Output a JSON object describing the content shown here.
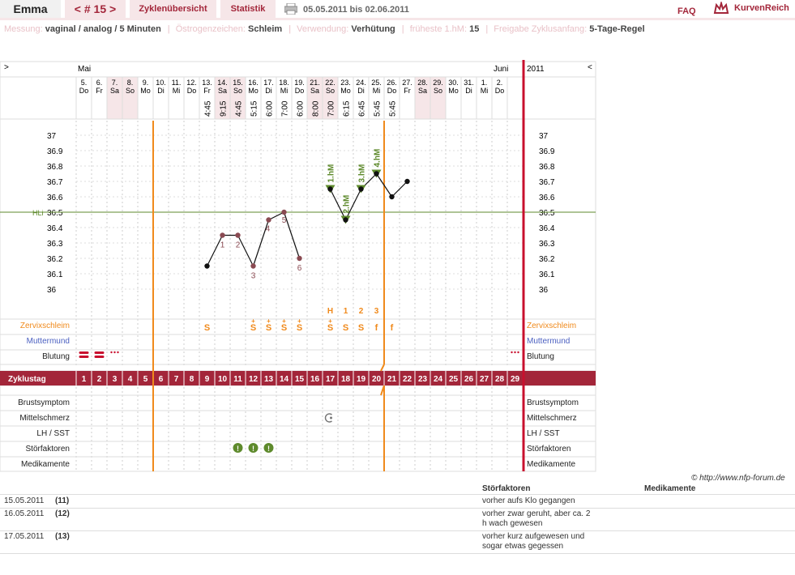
{
  "header": {
    "name": "Emma",
    "cycle_label": "< # 15 >",
    "tab_overview": "Zyklenübersicht",
    "tab_stats": "Statistik",
    "date_range": "05.05.2011 bis 02.06.2011",
    "faq": "FAQ",
    "brand": "KurvenReich"
  },
  "info": {
    "messung_label": "Messung:",
    "messung_value": "vaginal / analog / 5 Minuten",
    "oestrogen_label": "Östrogenzeichen:",
    "oestrogen_value": "Schleim",
    "verwendung_label": "Verwendung:",
    "verwendung_value": "Verhütung",
    "hm_label": "früheste 1.hM:",
    "hm_value": "15",
    "freigabe_label": "Freigabe Zyklusanfang:",
    "freigabe_value": "5-Tage-Regel"
  },
  "nav": {
    "left": ">",
    "right": "<",
    "month_may": "Mai",
    "month_june": "Juni",
    "year": "2011"
  },
  "days": [
    {
      "d": "5.",
      "w": "Do",
      "t": "",
      "we": false
    },
    {
      "d": "6.",
      "w": "Fr",
      "t": "",
      "we": false
    },
    {
      "d": "7.",
      "w": "Sa",
      "t": "",
      "we": true
    },
    {
      "d": "8.",
      "w": "So",
      "t": "",
      "we": true
    },
    {
      "d": "9.",
      "w": "Mo",
      "t": "",
      "we": false
    },
    {
      "d": "10.",
      "w": "Di",
      "t": "",
      "we": false
    },
    {
      "d": "11.",
      "w": "Mi",
      "t": "",
      "we": false
    },
    {
      "d": "12.",
      "w": "Do",
      "t": "",
      "we": false
    },
    {
      "d": "13.",
      "w": "Fr",
      "t": "4:45",
      "we": false
    },
    {
      "d": "14.",
      "w": "Sa",
      "t": "9:15",
      "we": true
    },
    {
      "d": "15.",
      "w": "So",
      "t": "4:45",
      "we": true
    },
    {
      "d": "16.",
      "w": "Mo",
      "t": "5:15",
      "we": false
    },
    {
      "d": "17.",
      "w": "Di",
      "t": "6:00",
      "we": false
    },
    {
      "d": "18.",
      "w": "Mi",
      "t": "7:00",
      "we": false
    },
    {
      "d": "19.",
      "w": "Do",
      "t": "6:00",
      "we": false
    },
    {
      "d": "21.",
      "w": "Sa",
      "t": "8:00",
      "we": true
    },
    {
      "d": "22.",
      "w": "So",
      "t": "7:00",
      "we": true
    },
    {
      "d": "23.",
      "w": "Mo",
      "t": "6:15",
      "we": false
    },
    {
      "d": "24.",
      "w": "Di",
      "t": "6:45",
      "we": false
    },
    {
      "d": "25.",
      "w": "Mi",
      "t": "5:45",
      "we": false
    },
    {
      "d": "26.",
      "w": "Do",
      "t": "5:45",
      "we": false
    },
    {
      "d": "27.",
      "w": "Fr",
      "t": "",
      "we": false
    },
    {
      "d": "28.",
      "w": "Sa",
      "t": "",
      "we": true
    },
    {
      "d": "29.",
      "w": "So",
      "t": "",
      "we": true
    },
    {
      "d": "30.",
      "w": "Mo",
      "t": "",
      "we": false
    },
    {
      "d": "31.",
      "w": "Di",
      "t": "",
      "we": false
    },
    {
      "d": "1.",
      "w": "Mi",
      "t": "",
      "we": false
    },
    {
      "d": "2.",
      "w": "Do",
      "t": "",
      "we": false
    }
  ],
  "chart_data": {
    "type": "line",
    "y_ticks": [
      "37",
      "36.9",
      "36.8",
      "36.7",
      "36.6",
      "36.5",
      "36.4",
      "36.3",
      "36.2",
      "36.1",
      "36"
    ],
    "ylim": [
      36.0,
      37.0
    ],
    "hili_label": "HLi",
    "hili_value": 36.5,
    "points": [
      {
        "day": 9,
        "y": 36.15,
        "label": ""
      },
      {
        "day": 10,
        "y": 36.35,
        "label": "1"
      },
      {
        "day": 11,
        "y": 36.35,
        "label": "2"
      },
      {
        "day": 12,
        "y": 36.15,
        "label": "3"
      },
      {
        "day": 13,
        "y": 36.45,
        "label": "4"
      },
      {
        "day": 14,
        "y": 36.5,
        "label": "5"
      },
      {
        "day": 15,
        "y": 36.2,
        "label": "6"
      },
      {
        "day": 17,
        "y": 36.65,
        "label": ""
      },
      {
        "day": 18,
        "y": 36.45,
        "label": ""
      },
      {
        "day": 19,
        "y": 36.65,
        "label": ""
      },
      {
        "day": 20,
        "y": 36.75,
        "label": ""
      },
      {
        "day": 21,
        "y": 36.6,
        "label": ""
      },
      {
        "day": 22,
        "y": 36.7,
        "label": ""
      }
    ],
    "hm": [
      {
        "day": 17,
        "y": 36.65,
        "label": "1.hM"
      },
      {
        "day": 18,
        "y": 36.45,
        "label": "2.hM"
      },
      {
        "day": 19,
        "y": 36.65,
        "label": "3.hM"
      },
      {
        "day": 20,
        "y": 36.75,
        "label": "4.hM"
      }
    ],
    "peak_labels": [
      {
        "day": 17,
        "text": "H"
      },
      {
        "day": 18,
        "text": "1"
      },
      {
        "day": 19,
        "text": "2"
      },
      {
        "day": 20,
        "text": "3"
      }
    ],
    "mucus": [
      {
        "day": 9,
        "text": "S",
        "plus": false
      },
      {
        "day": 12,
        "text": "S",
        "plus": true
      },
      {
        "day": 13,
        "text": "S",
        "plus": true
      },
      {
        "day": 14,
        "text": "S",
        "plus": true
      },
      {
        "day": 15,
        "text": "S",
        "plus": true
      },
      {
        "day": 17,
        "text": "S",
        "plus": true
      },
      {
        "day": 18,
        "text": "S",
        "plus": false
      },
      {
        "day": 19,
        "text": "S",
        "plus": false
      },
      {
        "day": 20,
        "text": "f",
        "plus": false
      },
      {
        "day": 21,
        "text": "f",
        "plus": false
      }
    ],
    "bleeding": [
      {
        "day": 1,
        "kind": "heavy"
      },
      {
        "day": 2,
        "kind": "heavy"
      },
      {
        "day": 3,
        "kind": "spot"
      },
      {
        "day": 29,
        "kind": "spot"
      }
    ],
    "stoer_days": [
      11,
      12,
      13
    ],
    "mittelschmerz_day": 17,
    "orange_lines": [
      5.5,
      20.5
    ]
  },
  "rows": {
    "zervix": "Zervixschleim",
    "muttermund": "Muttermund",
    "blutung": "Blutung",
    "zyklustag": "Zyklustag",
    "brust": "Brustsymptom",
    "mittel": "Mittelschmerz",
    "lh": "LH / SST",
    "stoer": "Störfaktoren",
    "medi": "Medikamente"
  },
  "cycle_days": [
    "1",
    "2",
    "3",
    "4",
    "5",
    "6",
    "7",
    "8",
    "9",
    "10",
    "11",
    "12",
    "13",
    "14",
    "15",
    "16",
    "17",
    "18",
    "19",
    "20",
    "21",
    "22",
    "23",
    "24",
    "25",
    "26",
    "27",
    "28",
    "29"
  ],
  "stoer_icon": "exclamation-icon",
  "mittel_icon": "pain-icon",
  "copyright": "© http://www.nfp-forum.de",
  "notes": {
    "col_stoer": "Störfaktoren",
    "col_medi": "Medikamente",
    "items": [
      {
        "date": "15.05.2011",
        "day": "(11)",
        "text1": "vorher aufs Klo gegangen",
        "text2": ""
      },
      {
        "date": "16.05.2011",
        "day": "(12)",
        "text1": "vorher zwar geruht, aber ca. 2",
        "text2": "h wach gewesen"
      },
      {
        "date": "17.05.2011",
        "day": "(13)",
        "text1": "vorher kurz aufgewesen und",
        "text2": "sogar etwas gegessen"
      }
    ]
  },
  "colors": {
    "accent": "#a3263a",
    "tab_bg": "#f6e6e8",
    "orange": "#f08a1c",
    "green": "#5e8a2c",
    "blue": "#4a5fc0"
  }
}
